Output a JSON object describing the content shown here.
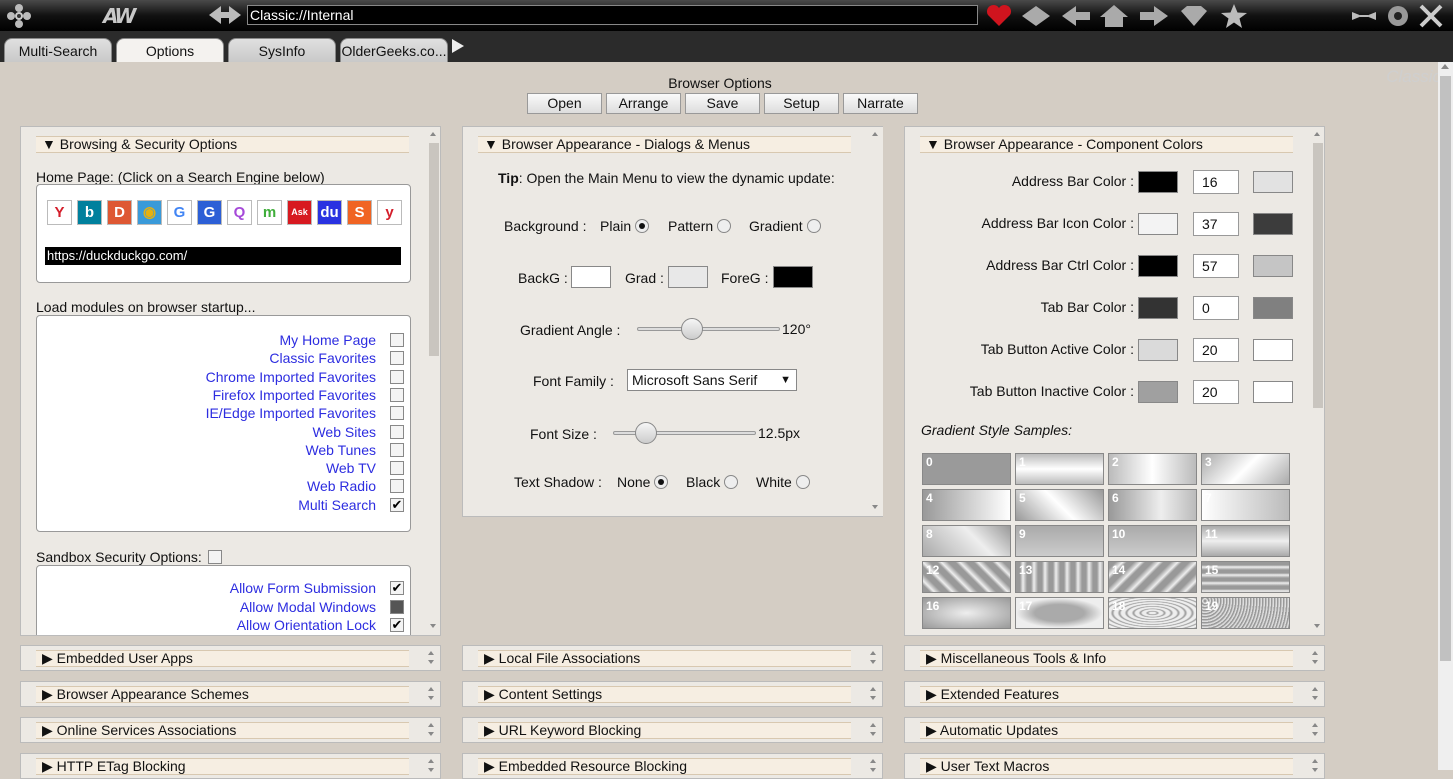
{
  "titlebar": {
    "address": "Classic://Internal",
    "logo_icon": "ornament-logo-icon",
    "brand_mark": "AW"
  },
  "tabs": [
    {
      "label": "Multi-Search",
      "active": false
    },
    {
      "label": "Options",
      "active": true
    },
    {
      "label": "SysInfo",
      "active": false
    },
    {
      "label": "OlderGeeks.co...",
      "active": false
    }
  ],
  "brand": "Classic",
  "page": {
    "title": "Browser Options",
    "buttons": [
      "Open",
      "Arrange",
      "Save",
      "Setup",
      "Narrate"
    ]
  },
  "browsing": {
    "header": "▼ Browsing & Security Options",
    "home_label": "Home Page: (Click on a Search Engine below)",
    "engines": [
      {
        "glyph": "Y",
        "color": "#d41e2b",
        "bg": "#fff"
      },
      {
        "glyph": "b",
        "color": "#fff",
        "bg": "#00809d"
      },
      {
        "glyph": "D",
        "color": "#fff",
        "bg": "#de5833"
      },
      {
        "glyph": "◉",
        "color": "#e8b10e",
        "bg": "#3a9ad9"
      },
      {
        "glyph": "G",
        "color": "#4285f4",
        "bg": "#fff"
      },
      {
        "glyph": "G",
        "color": "#fff",
        "bg": "#2c5fd6"
      },
      {
        "glyph": "Q",
        "color": "#a64ad9",
        "bg": "#fff"
      },
      {
        "glyph": "m",
        "color": "#3fae3a",
        "bg": "#fff"
      },
      {
        "glyph": "Ask",
        "color": "#fff",
        "bg": "#d71920"
      },
      {
        "glyph": "du",
        "color": "#fff",
        "bg": "#2932e1"
      },
      {
        "glyph": "S",
        "color": "#fff",
        "bg": "#f06423"
      },
      {
        "glyph": "y",
        "color": "#d41e2b",
        "bg": "#fff"
      }
    ],
    "home_url": "https://duckduckgo.com/",
    "modules_label": "Load modules on browser startup...",
    "modules": [
      {
        "label": "My Home Page",
        "checked": false
      },
      {
        "label": "Classic Favorites",
        "checked": false
      },
      {
        "label": "Chrome Imported Favorites",
        "checked": false
      },
      {
        "label": "Firefox Imported Favorites",
        "checked": false
      },
      {
        "label": "IE/Edge Imported Favorites",
        "checked": false
      },
      {
        "label": "Web Sites",
        "checked": false
      },
      {
        "label": "Web Tunes",
        "checked": false
      },
      {
        "label": "Web TV",
        "checked": false
      },
      {
        "label": "Web Radio",
        "checked": false
      },
      {
        "label": "Multi Search",
        "checked": true
      }
    ],
    "sandbox_label": "Sandbox Security Options:",
    "sandbox": [
      {
        "label": "Allow Form Submission",
        "checked": true
      },
      {
        "label": "Allow Modal Windows",
        "checked": false
      },
      {
        "label": "Allow Orientation Lock",
        "checked": true
      }
    ]
  },
  "dialogs": {
    "header": "▼ Browser Appearance - Dialogs & Menus",
    "tip_bold": "Tip",
    "tip_text": ": Open the Main Menu to view the dynamic update:",
    "background_label": "Background :",
    "bg_options": [
      {
        "label": "Plain",
        "selected": true
      },
      {
        "label": "Pattern",
        "selected": false
      },
      {
        "label": "Gradient",
        "selected": false
      }
    ],
    "backg_label": "BackG :",
    "grad_label": "Grad :",
    "foreg_label": "ForeG :",
    "backg_color": "#ffffff",
    "grad_color": "#e8e8e8",
    "foreg_color": "#000000",
    "gradient_angle_label": "Gradient Angle :",
    "gradient_angle_value": "120°",
    "gradient_angle_fraction": 0.36,
    "font_family_label": "Font Family :",
    "font_family_value": "Microsoft Sans Serif",
    "font_size_label": "Font Size :",
    "font_size_value": "12.5px",
    "font_size_fraction": 0.18,
    "shadow_label": "Text Shadow :",
    "shadow_options": [
      {
        "label": "None",
        "selected": true
      },
      {
        "label": "Black",
        "selected": false
      },
      {
        "label": "White",
        "selected": false
      }
    ]
  },
  "colors": {
    "header": "▼ Browser Appearance - Component Colors",
    "rows": [
      {
        "label": "Address Bar Color :",
        "swatch": "#000000",
        "value": "16",
        "preview": "#e2e2e2"
      },
      {
        "label": "Address Bar Icon Color :",
        "swatch": "#f3f3f3",
        "value": "37",
        "preview": "#3c3c3c"
      },
      {
        "label": "Address Bar Ctrl Color :",
        "swatch": "#000000",
        "value": "57",
        "preview": "#c5c5c5"
      },
      {
        "label": "Tab Bar Color :",
        "swatch": "#333333",
        "value": "0",
        "preview": "#808080"
      },
      {
        "label": "Tab Button Active Color :",
        "swatch": "#dadada",
        "value": "20",
        "preview": "#ffffff"
      },
      {
        "label": "Tab Button Inactive Color :",
        "swatch": "#a0a0a0",
        "value": "20",
        "preview": "#ffffff"
      }
    ],
    "samples_label": "Gradient Style Samples:",
    "samples": [
      "0",
      "1",
      "2",
      "3",
      "4",
      "5",
      "6",
      "7",
      "8",
      "9",
      "10",
      "11",
      "12",
      "13",
      "14",
      "15",
      "16",
      "17",
      "18",
      "19"
    ]
  },
  "collapsed": [
    [
      "▶ Embedded User Apps",
      "▶ Local File Associations",
      "▶ Miscellaneous Tools & Info"
    ],
    [
      "▶ Browser Appearance Schemes",
      "▶ Content Settings",
      "▶ Extended Features"
    ],
    [
      "▶ Online Services Associations",
      "▶ URL Keyword Blocking",
      "▶ Automatic Updates"
    ],
    [
      "▶ HTTP ETag Blocking",
      "▶ Embedded Resource Blocking",
      "▶ User Text Macros"
    ]
  ]
}
